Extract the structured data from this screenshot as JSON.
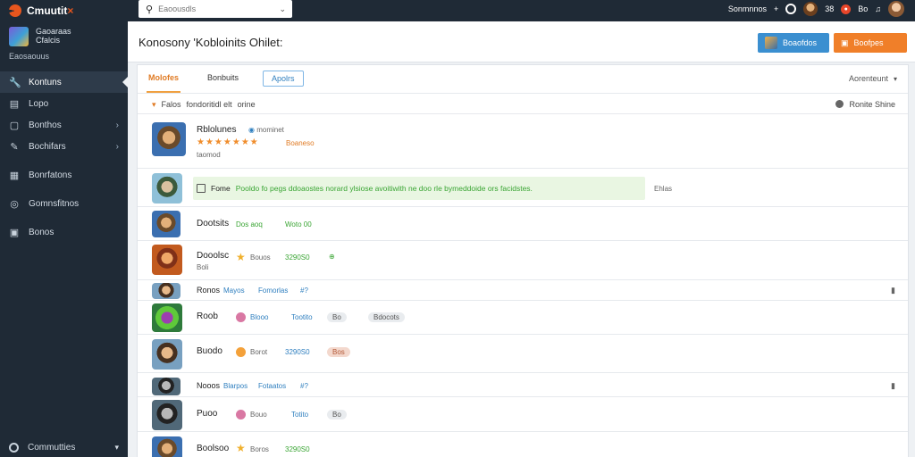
{
  "brand": {
    "title": "Cmuutit",
    "title_mark": "×"
  },
  "profile": {
    "line1": "Gaoaraas",
    "line2": "Cfalcis",
    "sub": "Eaosaouus"
  },
  "nav": [
    {
      "label": "Kontuns",
      "icon": "wrench-icon",
      "glyph": "🔧",
      "active": true
    },
    {
      "label": "Lopo",
      "icon": "book-icon",
      "glyph": "▤"
    },
    {
      "label": "Bonthos",
      "icon": "box-icon",
      "glyph": "▢",
      "chevron": "›"
    },
    {
      "label": "Bochifars",
      "icon": "pen-icon",
      "glyph": "✎",
      "chevron": "›"
    },
    {
      "label": "Bonrfatons",
      "icon": "clipboard-icon",
      "glyph": "▦"
    },
    {
      "label": "Gomnsfitnos",
      "icon": "globe-icon",
      "glyph": "◎"
    },
    {
      "label": "Bonos",
      "icon": "badge-icon",
      "glyph": "▣"
    }
  ],
  "sidebar_footer": {
    "label": "Commutties",
    "chevron": "▾"
  },
  "search": {
    "placeholder": "Eaoousdls"
  },
  "topbar": {
    "label": "Sonmnnos",
    "plus": "+",
    "badge1": "38",
    "badge2": "Bo"
  },
  "header": {
    "title": "Konosony 'Kobloinits Ohilet:",
    "btn_blue": "Boaofdos",
    "btn_orange": "Boofpes"
  },
  "tabs": {
    "tab1": "Molofes",
    "tab2": "Bonbuits",
    "tab3": "Apolrs",
    "sort": "Aorenteunt",
    "sort_chev": "▾"
  },
  "filterbar": {
    "left1": "Falos",
    "left2": "fondoritidl elt",
    "left3": "orine",
    "right": "Ronite Shine"
  },
  "rows": {
    "r1": {
      "name": "Rblolunes",
      "tag": "mominet",
      "stars": "★★★★★★★",
      "rating": "Boaneso",
      "sub": "taomod"
    },
    "r2": {
      "label1": "Fome",
      "text": "Pooldo fo pegs ddoaostes norard ylsiose avoitiwith ne doo rle bymeddoide ors facidstes.",
      "right": "Ehlas"
    },
    "r3": {
      "name": "Dootsits",
      "v1": "Dos aoq",
      "v2": "Woto 00"
    },
    "r4": {
      "name": "Dooolsc",
      "v1": "Bouos",
      "v2": "3290S0",
      "sub": "Boli"
    },
    "r5": {
      "name": "Ronos",
      "v1": "Mayos",
      "v2": "Fomorlas",
      "v3": "#?"
    },
    "r6": {
      "name": "Roob",
      "v1": "Blooo",
      "v2": "Tootito",
      "pill1": "Bo",
      "pill2": "Bdocots"
    },
    "r7": {
      "name": "Buodo",
      "v1": "Borot",
      "v2": "3290S0",
      "pill": "Bos"
    },
    "r8": {
      "name": "Nooos",
      "v1": "Blarpos",
      "v2": "Fotaatos",
      "v3": "#?"
    },
    "r9": {
      "name": "Puoo",
      "v1": "Bouo",
      "v2": "Totito",
      "pill": "Bo"
    },
    "r10": {
      "name": "Boolsoo",
      "v1": "Boros",
      "v2": "3290S0"
    }
  }
}
